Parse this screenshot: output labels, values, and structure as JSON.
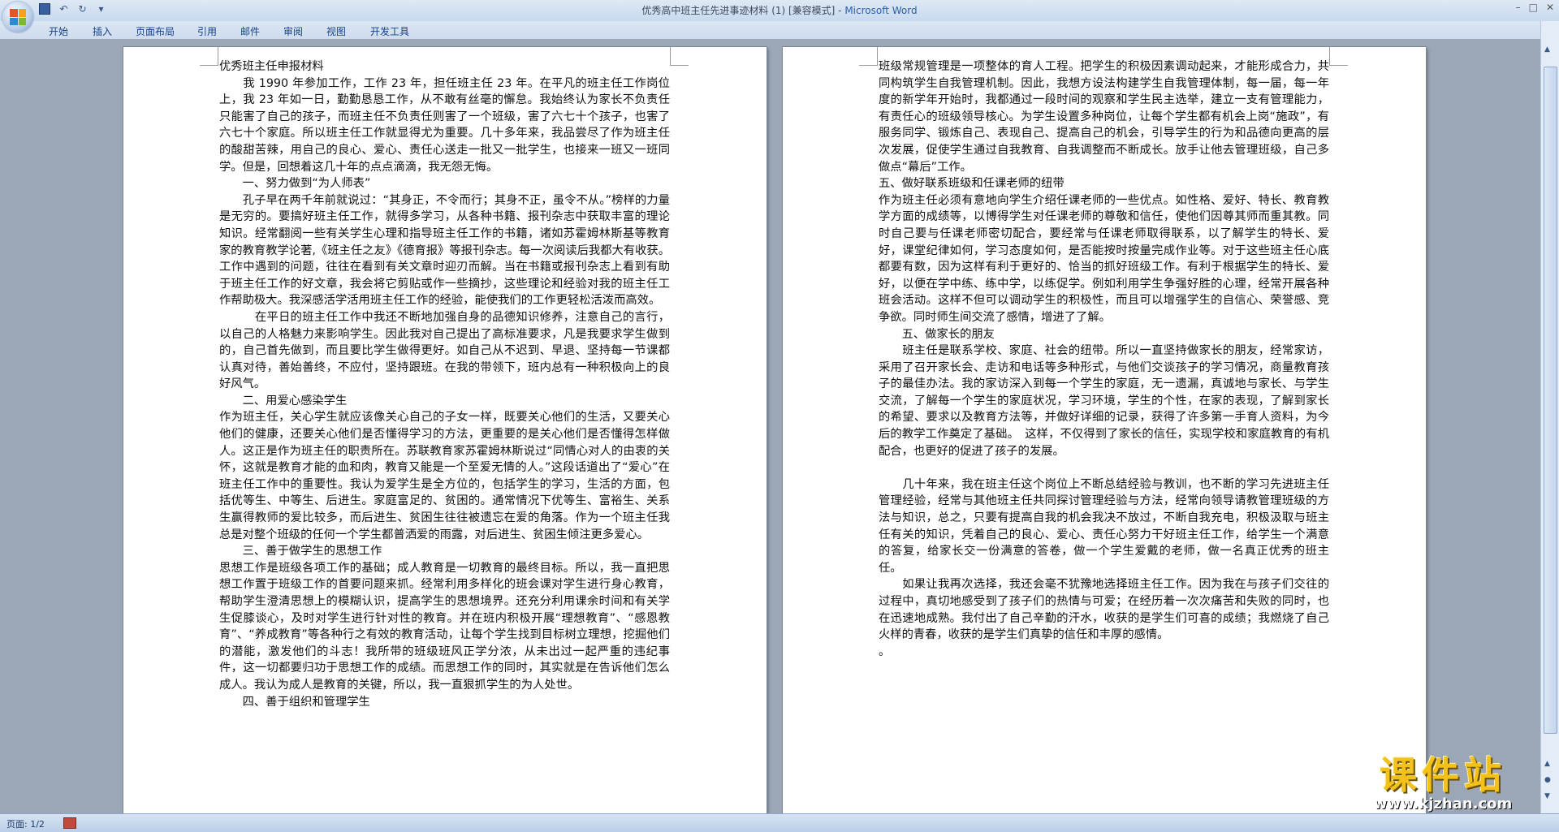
{
  "window": {
    "title_doc": "优秀高中班主任先进事迹材料 (1) [兼容模式] - ",
    "title_app": "Microsoft Word",
    "controls": [
      "–",
      "□",
      "✕"
    ]
  },
  "quick_access": {
    "icons": [
      "save-icon",
      "undo-icon",
      "redo-icon",
      "customize-icon"
    ],
    "more": "▾"
  },
  "ribbon_tabs": [
    "开始",
    "插入",
    "页面布局",
    "引用",
    "邮件",
    "审阅",
    "视图",
    "开发工具"
  ],
  "page1": {
    "paragraphs": [
      "优秀班主任申报材料",
      "　　我 1990 年参加工作，工作 23 年，担任班主任 23 年。在平凡的班主任工作岗位上，我 23 年如一日，勤勤恳恳工作，从不敢有丝毫的懈怠。我始终认为家长不负责任只能害了自己的孩子，而班主任不负责任则害了一个班级，害了六七十个孩子，也害了六七十个家庭。所以班主任工作就显得尤为重要。几十多年来，我品尝尽了作为班主任的酸甜苦辣，用自己的良心、爱心、责任心送走一批又一批学生，也接来一班又一班同学。但是，回想着这几十年的点点滴滴，我无怨无悔。",
      "　　一、努力做到“为人师表”",
      "　　孔子早在两千年前就说过：“其身正，不令而行；其身不正，虽令不从。”榜样的力量是无穷的。要搞好班主任工作，就得多学习，从各种书籍、报刊杂志中获取丰富的理论知识。经常翻阅一些有关学生心理和指导班主任工作的书籍，诸如苏霍姆林斯基等教育家的教育教学论著,《班主任之友》《德育报》等报刊杂志。每一次阅读后我都大有收获。工作中遇到的问题，往往在看到有关文章时迎刃而解。当在书籍或报刊杂志上看到有助于班主任工作的好文章，我会将它剪贴或作一些摘抄，这些理论和经验对我的班主任工作帮助极大。我深感活学活用班主任工作的经验，能使我们的工作更轻松活泼而高效。",
      "　　　在平日的班主任工作中我还不断地加强自身的品德知识修养，注意自己的言行，以自己的人格魅力来影响学生。因此我对自己提出了高标准要求，凡是我要求学生做到的，自己首先做到，而且要比学生做得更好。如自己从不迟到、早退、坚持每一节课都认真对待，善始善终，不应付，坚持跟班。在我的带领下，班内总有一种积极向上的良好风气。",
      "　　二、用爱心感染学生",
      "作为班主任，关心学生就应该像关心自己的子女一样，既要关心他们的生活，又要关心他们的健康，还要关心他们是否懂得学习的方法，更重要的是关心他们是否懂得怎样做人。这正是作为班主任的职责所在。苏联教育家苏霍姆林斯说过“同情心对人的由衷的关怀，这就是教育才能的血和肉，教育又能是一个至爱无情的人。”这段话道出了“爱心”在班主任工作中的重要性。我认为爱学生是全方位的，包括学生的学习，生活的方面，包括优等生、中等生、后进生。家庭富足的、贫困的。通常情况下优等生、富裕生、关系生赢得教师的爱比较多，而后进生、贫困生往往被遗忘在爱的角落。作为一个班主任我总是对整个班级的任何一个学生都普洒爱的雨露，对后进生、贫困生倾注更多爱心。",
      "　　三、善于做学生的思想工作",
      "思想工作是班级各项工作的基础；成人教育是一切教育的最终目标。所以，我一直把思想工作置于班级工作的首要问题来抓。经常利用多样化的班会课对学生进行身心教育，帮助学生澄清思想上的模糊认识，提高学生的思想境界。还充分利用课余时间和有关学生促膝谈心，及时对学生进行针对性的教育。并在班内积极开展“理想教育”、“感恩教育”、“养成教育”等各种行之有效的教育活动，让每个学生找到目标树立理想，挖掘他们的潜能，激发他们的斗志！我所带的班级班风正学分浓，从未出过一起严重的违纪事件，这一切都要归功于思想工作的成绩。而思想工作的同时，其实就是在告诉他们怎么成人。我认为成人是教育的关键，所以，我一直狠抓学生的为人处世。",
      "　　四、善于组织和管理学生"
    ]
  },
  "page2": {
    "paragraphs": [
      "班级常规管理是一项整体的育人工程。把学生的积极因素调动起来，才能形成合力，共同构筑学生自我管理机制。因此，我想方设法构建学生自我管理体制，每一届，每一年度的新学年开始时，我都通过一段时间的观察和学生民主选举，建立一支有管理能力，有责任心的班级领导核心。为学生设置多种岗位，让每个学生都有机会上岗“施政”，有服务同学、锻炼自己、表现自己、提高自己的机会，引导学生的行为和品德向更高的层次发展，促使学生通过自我教育、自我调整而不断成长。放手让他去管理班级，自己多做点“幕后”工作。",
      "五、做好联系班级和任课老师的纽带",
      "作为班主任必须有意地向学生介绍任课老师的一些优点。如性格、爱好、特长、教育教学方面的成绩等，以博得学生对任课老师的尊敬和信任，使他们因尊其师而重其教。同时自己要与任课老师密切配合，要经常与任课老师取得联系，以了解学生的特长、爱好，课堂纪律如何，学习态度如何，是否能按时按量完成作业等。对于这些班主任心底都要有数，因为这样有利于更好的、恰当的抓好班级工作。有利于根据学生的特长、爱好，以便在学中练、练中学，以练促学。例如利用学生争强好胜的心理，经常开展各种班会活动。这样不但可以调动学生的积极性，而且可以增强学生的自信心、荣誉感、竞争欲。同时师生间交流了感情，增进了了解。",
      "　　五、做家长的朋友",
      "　　班主任是联系学校、家庭、社会的纽带。所以一直坚持做家长的朋友，经常家访，采用了召开家长会、走访和电话等多种形式，与他们交谈孩子的学习情况，商量教育孩子的最佳办法。我的家访深入到每一个学生的家庭，无一遗漏，真诚地与家长、与学生交流，了解每一个学生的家庭状况，学习环境，学生的个性，在家的表现，了解到家长的希望、要求以及教育方法等，并做好详细的记录，获得了许多第一手育人资料，为今后的教学工作奠定了基础。　这样，不仅得到了家长的信任，实现学校和家庭教育的有机配合，也更好的促进了孩子的发展。",
      "　",
      "　　几十年来，我在班主任这个岗位上不断总结经验与教训，也不断的学习先进班主任管理经验，经常与其他班主任共同探讨管理经验与方法，经常向领导请教管理班级的方法与知识，总之，只要有提高自我的机会我决不放过，不断自我充电，积极汲取与班主任有关的知识，凭着自己的良心、爱心、责任心努力干好班主任工作，给学生一个满意的答复，给家长交一份满意的答卷，做一个学生爱戴的老师，做一名真正优秀的班主任。",
      "　　如果让我再次选择，我还会毫不犹豫地选择班主任工作。因为我在与孩子们交往的过程中，真切地感受到了孩子们的热情与可爱；在经历着一次次痛苦和失败的同时，也在迅速地成熟。我付出了自己辛勤的汗水，收获的是学生们可喜的成绩；我燃烧了自己火样的青春，收获的是学生们真挚的信任和丰厚的感情。",
      "。"
    ]
  },
  "statusbar": {
    "page_count": "页面: 1/2"
  },
  "watermark": {
    "cn": "课件站",
    "url": "www.kjzhan.com"
  },
  "colors": {
    "ribbon_text": "#15428b",
    "app_title": "#2a5fa8",
    "workspace": "#9ba7b7",
    "watermark": "#f2c21b"
  }
}
